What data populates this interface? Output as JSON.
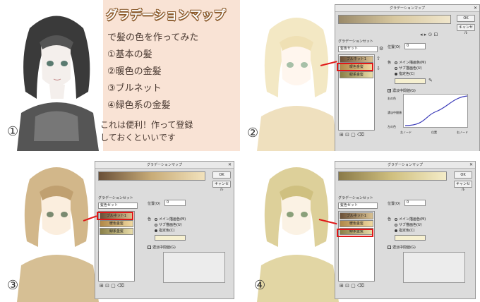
{
  "notes": {
    "title": "グラデーションマップ",
    "lines": [
      "で髪の色を作ってみた",
      "①基本の髪",
      "②暖色の金髪",
      "③ブルネット",
      "④緑色系の金髪",
      "これは便利！作って登録",
      "しておくといいです"
    ]
  },
  "panel_numbers": [
    "①",
    "②",
    "③",
    "④"
  ],
  "dialog": {
    "title": "グラデーションマップ",
    "ok": "OK",
    "cancel": "キャンセル",
    "set_group": "グラデーションセット",
    "set_select": "髪色セット",
    "position_label": "位置(O)",
    "position_value": "0",
    "color_label": "色",
    "radio_main": "メイン描画色(M)",
    "radio_sub": "サブ描画色(U)",
    "radio_custom": "指定色(C)",
    "opacity_label": "不透明度(Y)",
    "curve_label": "濃淡中間値(G)",
    "axis_left": "左ノード",
    "axis_mid": "位置",
    "axis_right": "右ノード",
    "axis_top": "右の色",
    "axis_bottom": "左の色",
    "axis_center": "濃淡中間値",
    "list_items": [
      "ブルネット1",
      "暖色金髪",
      "緑系金髪"
    ]
  },
  "colors": {
    "accent_red": "#e01818",
    "note_bg": "#f9e3d5"
  }
}
